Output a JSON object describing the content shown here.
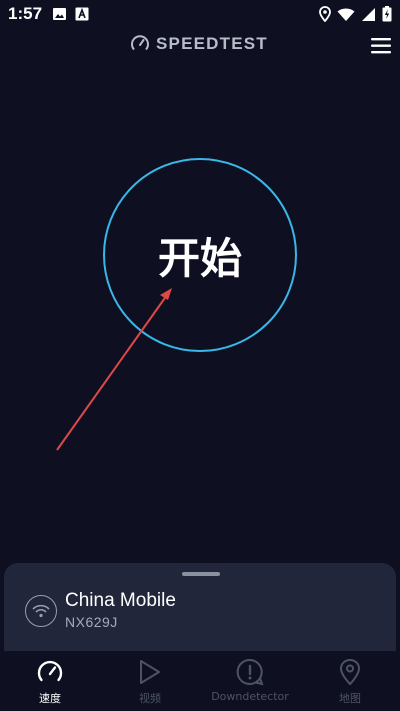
{
  "status_bar": {
    "time": "1:57",
    "icons": [
      "image-icon",
      "font-a-icon",
      "location-icon",
      "wifi-icon",
      "signal-icon",
      "battery-charging-icon"
    ]
  },
  "header": {
    "brand": "SPEEDTEST",
    "brand_icon": "speedometer-icon",
    "menu_icon": "hamburger-menu-icon"
  },
  "main": {
    "start_label": "开始",
    "accent_color": "#39b7e8",
    "annotation_color": "#e04848"
  },
  "connection": {
    "provider": "China Mobile",
    "ssid": "NX629J",
    "icon": "wifi-icon"
  },
  "nav": {
    "items": [
      {
        "label": "速度",
        "icon": "speedometer-icon",
        "active": true
      },
      {
        "label": "视频",
        "icon": "play-icon",
        "active": false
      },
      {
        "label": "Downdetector",
        "icon": "alert-bubble-icon",
        "active": false
      },
      {
        "label": "地图",
        "icon": "map-pin-icon",
        "active": false
      }
    ]
  },
  "colors": {
    "background": "#0e1021",
    "sheet": "#22263a",
    "inactive": "#4d5366"
  }
}
